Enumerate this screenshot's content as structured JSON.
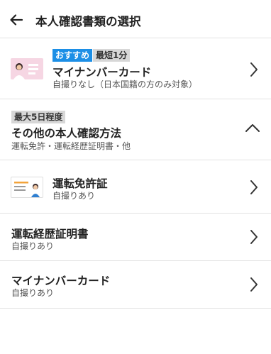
{
  "header": {
    "title": "本人確認書類の選択",
    "back_icon": "arrow-left-icon"
  },
  "recommended": {
    "badge_recommended": "おすすめ",
    "badge_time": "最短1分",
    "title": "マイナンバーカード",
    "subtitle": "自撮りなし（日本国籍の方のみ対象）",
    "icon": "my-number-card-icon"
  },
  "other_section": {
    "badge_time": "最大5日程度",
    "title": "その他の本人確認方法",
    "subtitle": "運転免許・運転経歴証明書・他",
    "toggle_icon": "chevron-up-icon"
  },
  "options": [
    {
      "title": "運転免許証",
      "subtitle": "自撮りあり",
      "icon": "drivers-license-icon"
    },
    {
      "title": "運転経歴証明書",
      "subtitle": "自撮りあり"
    },
    {
      "title": "マイナンバーカード",
      "subtitle": "自撮りあり"
    }
  ],
  "colors": {
    "accent_blue": "#1c8fe6",
    "badge_gray": "#d7d7d7",
    "card_pink": "#f6d6e3",
    "card_orange": "#f2a33a",
    "divider": "#e2e2e2"
  }
}
